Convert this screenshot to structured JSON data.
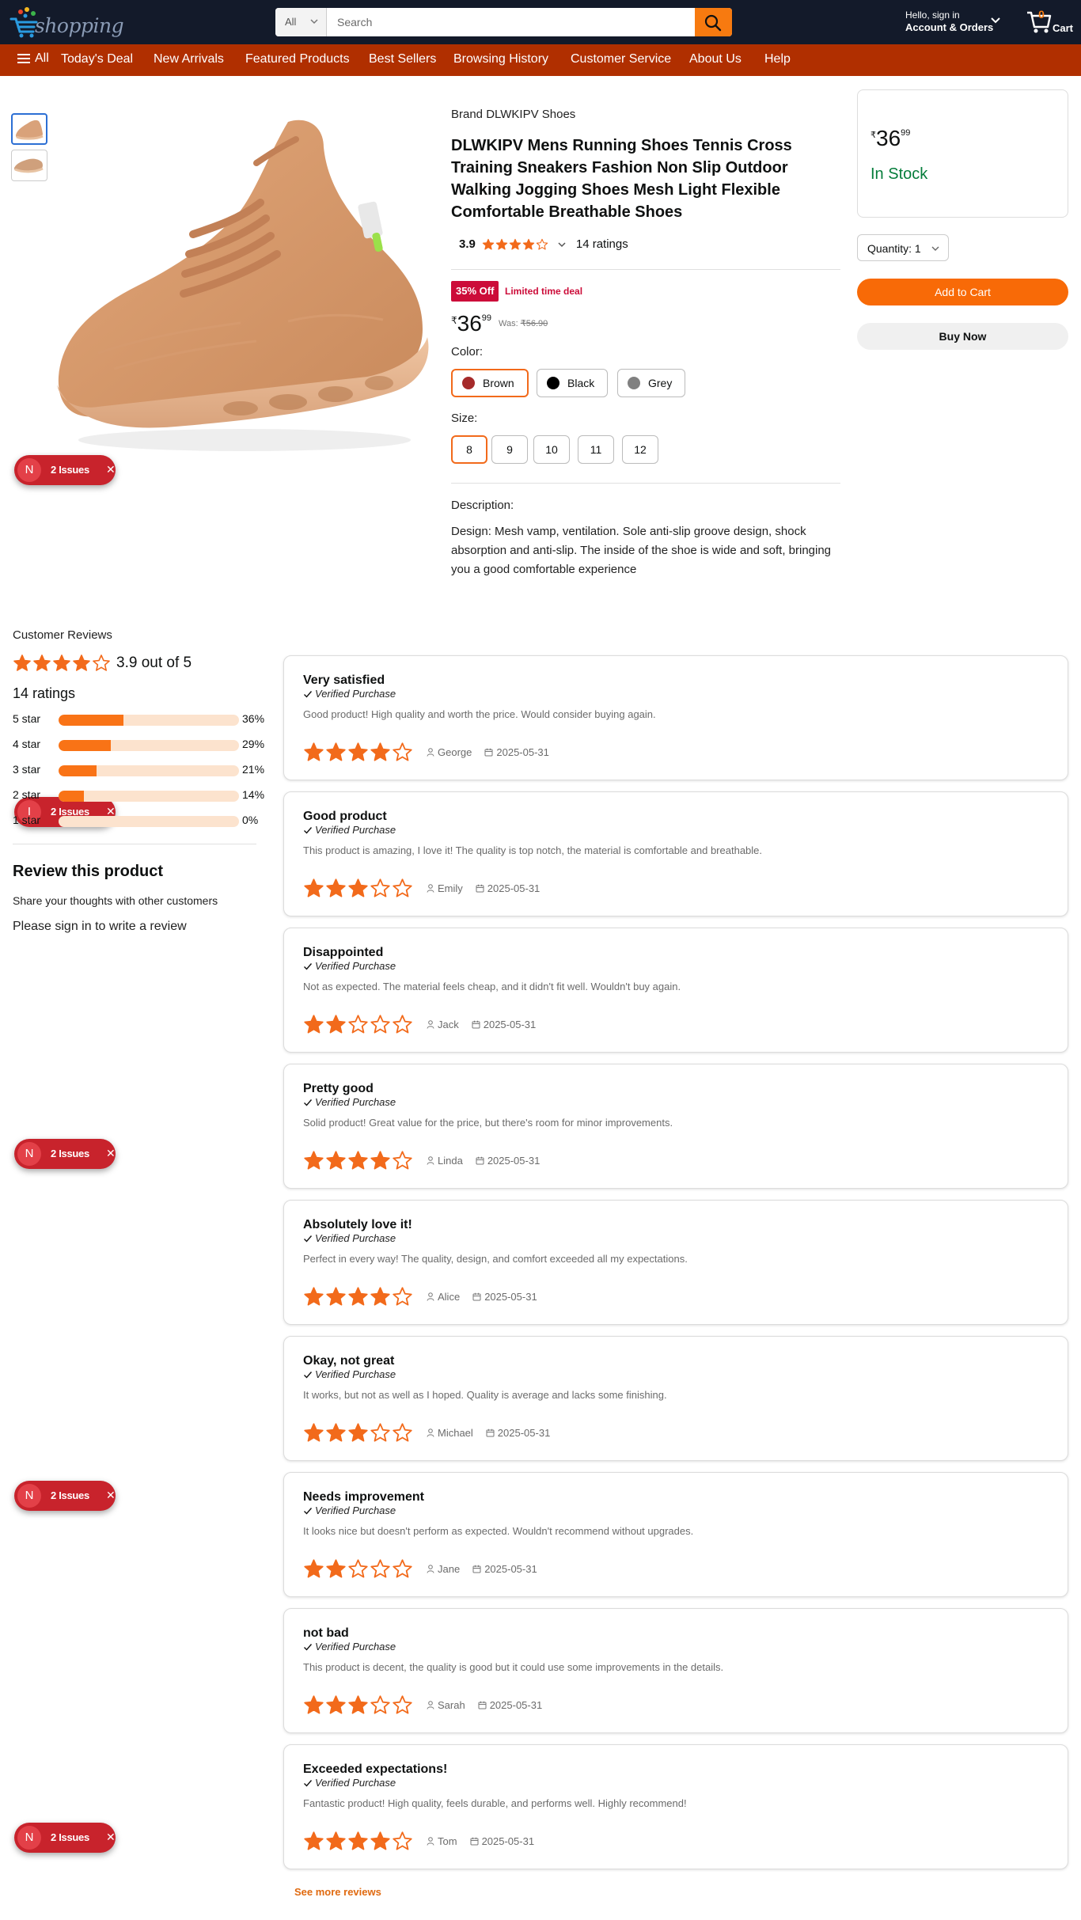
{
  "header": {
    "logo_text": "shopping",
    "search": {
      "category": "All",
      "placeholder": "Search"
    },
    "account": {
      "line1": "Hello, sign in",
      "line2": "Account & Orders"
    },
    "cart": {
      "count": "0",
      "label": "Cart"
    }
  },
  "nav": {
    "all_label": "All",
    "items": [
      "Today's Deal",
      "New Arrivals",
      "Featured Products",
      "Best Sellers",
      "Browsing History",
      "Customer Service",
      "About Us",
      "Help"
    ]
  },
  "issues": {
    "circle_letters": [
      "N",
      "I",
      "N",
      "N",
      "N"
    ],
    "label": "2 Issues"
  },
  "product": {
    "brand": "Brand DLWKIPV Shoes",
    "title": "DLWKIPV Mens Running Shoes Tennis Cross Training Sneakers Fashion Non Slip Outdoor Walking Jogging Shoes Mesh Light Flexible Comfortable Breathable Shoes",
    "rating": "3.9",
    "rating_value": 3.9,
    "rating_count": "14 ratings",
    "deal_badge": "35% Off",
    "deal_text": "Limited time deal",
    "price_symbol": "₹",
    "price_whole": "36",
    "price_fraction": "99",
    "was_label": "Was:",
    "was_price": "₹56.90",
    "color_label": "Color:",
    "colors": [
      {
        "name": "Brown",
        "hex": "#a52a2a",
        "selected": true
      },
      {
        "name": "Black",
        "hex": "#000000",
        "selected": false
      },
      {
        "name": "Grey",
        "hex": "#808080",
        "selected": false
      }
    ],
    "size_label": "Size:",
    "sizes": [
      "8",
      "9",
      "10",
      "11",
      "12"
    ],
    "selected_size": "8",
    "description_label": "Description:",
    "description": "Design: Mesh vamp, ventilation. Sole anti-slip groove design, shock absorption and anti-slip. The inside of the shoe is wide and soft, bringing you a good comfortable experience"
  },
  "buybox": {
    "price_symbol": "₹",
    "price_whole": "36",
    "price_fraction": "99",
    "stock": "In Stock",
    "quantity": "Quantity: 1",
    "add_to_cart": "Add to Cart",
    "buy_now": "Buy Now"
  },
  "reviews_summary": {
    "title": "Customer Reviews",
    "average_text": "3.9 out of 5",
    "average_value": 3.9,
    "total": "14 ratings",
    "bars": [
      {
        "label": "5 star",
        "pct_text": "36%",
        "pct": 36
      },
      {
        "label": "4 star",
        "pct_text": "29%",
        "pct": 29
      },
      {
        "label": "3 star",
        "pct_text": "21%",
        "pct": 21
      },
      {
        "label": "2 star",
        "pct_text": "14%",
        "pct": 14
      },
      {
        "label": "1 star",
        "pct_text": "0%",
        "pct": 0
      }
    ],
    "review_title": "Review this product",
    "review_sub": "Share your thoughts with other customers",
    "sign_in_prompt": "Please sign in to write a review"
  },
  "reviews": [
    {
      "title": "Very satisfied",
      "verified": "Verified Purchase",
      "body": "Good product! High quality and worth the price. Would consider buying again.",
      "stars": 4,
      "author": "George",
      "date": "2025-05-31"
    },
    {
      "title": "Good product",
      "verified": "Verified Purchase",
      "body": "This product is amazing, I love it! The quality is top notch, the material is comfortable and breathable.",
      "stars": 3,
      "author": "Emily",
      "date": "2025-05-31"
    },
    {
      "title": "Disappointed",
      "verified": "Verified Purchase",
      "body": "Not as expected. The material feels cheap, and it didn't fit well. Wouldn't buy again.",
      "stars": 2,
      "author": "Jack",
      "date": "2025-05-31"
    },
    {
      "title": "Pretty good",
      "verified": "Verified Purchase",
      "body": "Solid product! Great value for the price, but there's room for minor improvements.",
      "stars": 4,
      "author": "Linda",
      "date": "2025-05-31"
    },
    {
      "title": "Absolutely love it!",
      "verified": "Verified Purchase",
      "body": "Perfect in every way! The quality, design, and comfort exceeded all my expectations.",
      "stars": 4,
      "author": "Alice",
      "date": "2025-05-31"
    },
    {
      "title": "Okay, not great",
      "verified": "Verified Purchase",
      "body": "It works, but not as well as I hoped. Quality is average and lacks some finishing.",
      "stars": 3,
      "author": "Michael",
      "date": "2025-05-31"
    },
    {
      "title": "Needs improvement",
      "verified": "Verified Purchase",
      "body": "It looks nice but doesn't perform as expected. Wouldn't recommend without upgrades.",
      "stars": 2,
      "author": "Jane",
      "date": "2025-05-31"
    },
    {
      "title": "not bad",
      "verified": "Verified Purchase",
      "body": "This product is decent, the quality is good but it could use some improvements in the details.",
      "stars": 3,
      "author": "Sarah",
      "date": "2025-05-31"
    },
    {
      "title": "Exceeded expectations!",
      "verified": "Verified Purchase",
      "body": "Fantastic product! High quality, feels durable, and performs well. Highly recommend!",
      "stars": 4,
      "author": "Tom",
      "date": "2025-05-31"
    }
  ],
  "see_more": "See more reviews",
  "colors": {
    "header_bg": "#131a2a",
    "nav_bg": "#b02f00",
    "accent": "#f77a10",
    "star": "#f26a1b",
    "issue_red": "#c8232c",
    "in_stock": "#067d3b"
  }
}
